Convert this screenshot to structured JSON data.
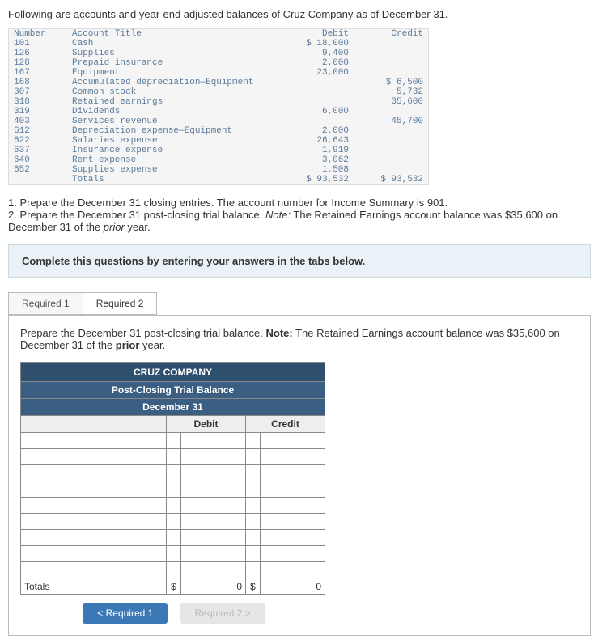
{
  "intro": "Following are accounts and year-end adjusted balances of Cruz Company as of December 31.",
  "ledger": {
    "headers": {
      "number": "Number",
      "title": "Account Title",
      "debit": "Debit",
      "credit": "Credit"
    },
    "rows": [
      {
        "n": "101",
        "t": "Cash",
        "d": "$ 18,000",
        "c": ""
      },
      {
        "n": "126",
        "t": "Supplies",
        "d": "9,400",
        "c": ""
      },
      {
        "n": "128",
        "t": "Prepaid insurance",
        "d": "2,000",
        "c": ""
      },
      {
        "n": "167",
        "t": "Equipment",
        "d": "23,000",
        "c": ""
      },
      {
        "n": "168",
        "t": "Accumulated depreciation—Equipment",
        "d": "",
        "c": "$ 6,500"
      },
      {
        "n": "307",
        "t": "Common stock",
        "d": "",
        "c": "5,732"
      },
      {
        "n": "318",
        "t": "Retained earnings",
        "d": "",
        "c": "35,600"
      },
      {
        "n": "319",
        "t": "Dividends",
        "d": "6,000",
        "c": ""
      },
      {
        "n": "403",
        "t": "Services revenue",
        "d": "",
        "c": "45,700"
      },
      {
        "n": "612",
        "t": "Depreciation expense—Equipment",
        "d": "2,000",
        "c": ""
      },
      {
        "n": "622",
        "t": "Salaries expense",
        "d": "26,643",
        "c": ""
      },
      {
        "n": "637",
        "t": "Insurance expense",
        "d": "1,919",
        "c": ""
      },
      {
        "n": "640",
        "t": "Rent expense",
        "d": "3,062",
        "c": ""
      },
      {
        "n": "652",
        "t": "Supplies expense",
        "d": "1,508",
        "c": ""
      }
    ],
    "totals": {
      "t": "Totals",
      "d": "$ 93,532",
      "c": "$ 93,532"
    }
  },
  "instr1": "1. Prepare the December 31 closing entries. The account number for Income Summary is 901.",
  "instr2a": "2. Prepare the December 31 post-closing trial balance. ",
  "instr2note": "Note:",
  "instr2b": " The Retained Earnings account balance was $35,600 on December 31 of the ",
  "instr2prior": "prior",
  "instr2c": " year.",
  "instruction_box": "Complete this questions by entering your answers in the tabs below.",
  "tabs": {
    "req1": "Required 1",
    "req2": "Required 2"
  },
  "tab_desc_a": "Prepare the December 31 post-closing trial balance. ",
  "tab_desc_note": "Note:",
  "tab_desc_b": " The Retained Earnings account balance was $35,600 on December 31 of the ",
  "tab_desc_prior": "prior",
  "tab_desc_c": " year.",
  "answer": {
    "company": "CRUZ COMPANY",
    "title": "Post-Closing Trial Balance",
    "date": "December 31",
    "debit_hdr": "Debit",
    "credit_hdr": "Credit",
    "totals_label": "Totals",
    "dollar": "$",
    "zero": "0"
  },
  "nav": {
    "prev": "<  Required 1",
    "next": "Required 2  >"
  },
  "chart_data": {
    "type": "table",
    "title": "Adjusted Trial Balance — Cruz Company — December 31",
    "columns": [
      "Number",
      "Account Title",
      "Debit",
      "Credit"
    ],
    "rows": [
      [
        101,
        "Cash",
        18000,
        null
      ],
      [
        126,
        "Supplies",
        9400,
        null
      ],
      [
        128,
        "Prepaid insurance",
        2000,
        null
      ],
      [
        167,
        "Equipment",
        23000,
        null
      ],
      [
        168,
        "Accumulated depreciation—Equipment",
        null,
        6500
      ],
      [
        307,
        "Common stock",
        null,
        5732
      ],
      [
        318,
        "Retained earnings",
        null,
        35600
      ],
      [
        319,
        "Dividends",
        6000,
        null
      ],
      [
        403,
        "Services revenue",
        null,
        45700
      ],
      [
        612,
        "Depreciation expense—Equipment",
        2000,
        null
      ],
      [
        622,
        "Salaries expense",
        26643,
        null
      ],
      [
        637,
        "Insurance expense",
        1919,
        null
      ],
      [
        640,
        "Rent expense",
        3062,
        null
      ],
      [
        652,
        "Supplies expense",
        1508,
        null
      ]
    ],
    "totals": {
      "debit": 93532,
      "credit": 93532
    }
  }
}
